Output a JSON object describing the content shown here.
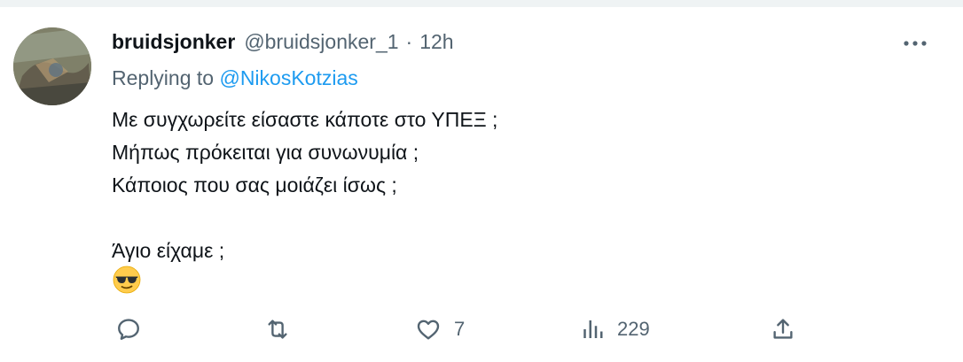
{
  "colors": {
    "text": "#0f1419",
    "secondary": "#536471",
    "link": "#1d9bf0",
    "divider": "#eff3f4"
  },
  "tweet": {
    "author_name": "bruidsjonker",
    "author_handle": "@bruidsjonker_1",
    "separator": "·",
    "timestamp": "12h",
    "replying_prefix": "Replying to",
    "replying_mention": "@NikosKotzias",
    "lines": [
      "Με συγχωρείτε είσαστε κάποτε στο ΥΠΕΞ ;",
      "Μήπως πρόκειται για συνωνυμία ;",
      "Κάποιος που σας μοιάζει ίσως ;",
      "Άγιο είχαμε ;"
    ],
    "emoji": "smiling-face-with-sunglasses"
  },
  "actions": {
    "reply": {
      "icon": "reply-icon",
      "count": ""
    },
    "retweet": {
      "icon": "retweet-icon",
      "count": ""
    },
    "like": {
      "icon": "heart-icon",
      "count": "7"
    },
    "views": {
      "icon": "views-icon",
      "count": "229"
    },
    "share": {
      "icon": "share-icon"
    }
  }
}
